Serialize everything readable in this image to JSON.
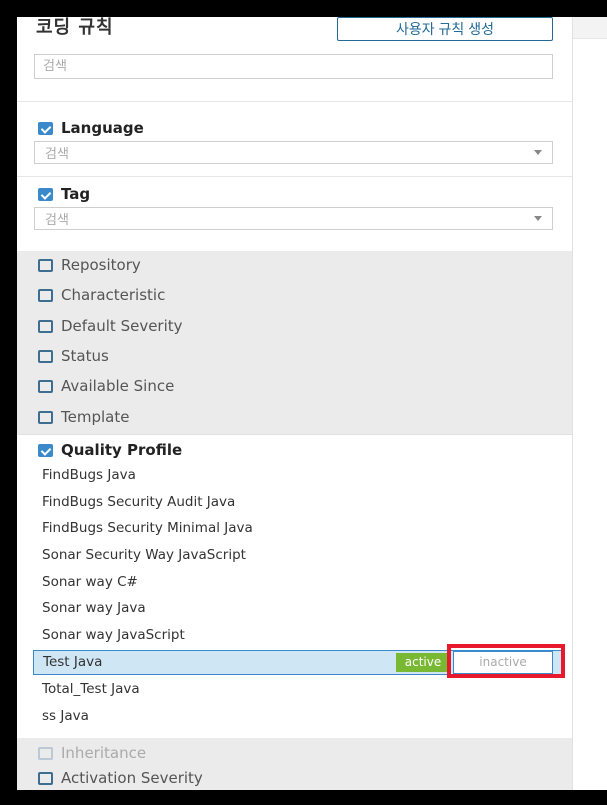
{
  "header": {
    "title": "코딩 규칙",
    "create_button": "사용자 규칙 생성",
    "search_placeholder": "검색"
  },
  "facets": {
    "language": {
      "label": "Language",
      "checked": true,
      "placeholder": "검색"
    },
    "tag": {
      "label": "Tag",
      "checked": true,
      "placeholder": "검색"
    },
    "repository": {
      "label": "Repository",
      "checked": false
    },
    "characteristic": {
      "label": "Characteristic",
      "checked": false
    },
    "default_severity": {
      "label": "Default Severity",
      "checked": false
    },
    "status": {
      "label": "Status",
      "checked": false
    },
    "available_since": {
      "label": "Available Since",
      "checked": false
    },
    "template": {
      "label": "Template",
      "checked": false
    },
    "quality_profile": {
      "label": "Quality Profile",
      "checked": true
    },
    "inheritance": {
      "label": "Inheritance",
      "checked": false,
      "disabled": true
    },
    "activation_severity": {
      "label": "Activation Severity",
      "checked": false
    }
  },
  "quality_profiles": [
    "FindBugs Java",
    "FindBugs Security Audit Java",
    "FindBugs Security Minimal Java",
    "Sonar Security Way JavaScript",
    "Sonar way C#",
    "Sonar way Java",
    "Sonar way JavaScript",
    "Test Java",
    "Total_Test Java",
    "ss Java"
  ],
  "selected_profile": {
    "name": "Test Java",
    "active_label": "active",
    "inactive_label": "inactive"
  },
  "colors": {
    "accent": "#3a8acb",
    "active_tag": "#79b832",
    "highlight": "#e8192c",
    "selected_row": "#cfe6f5"
  }
}
